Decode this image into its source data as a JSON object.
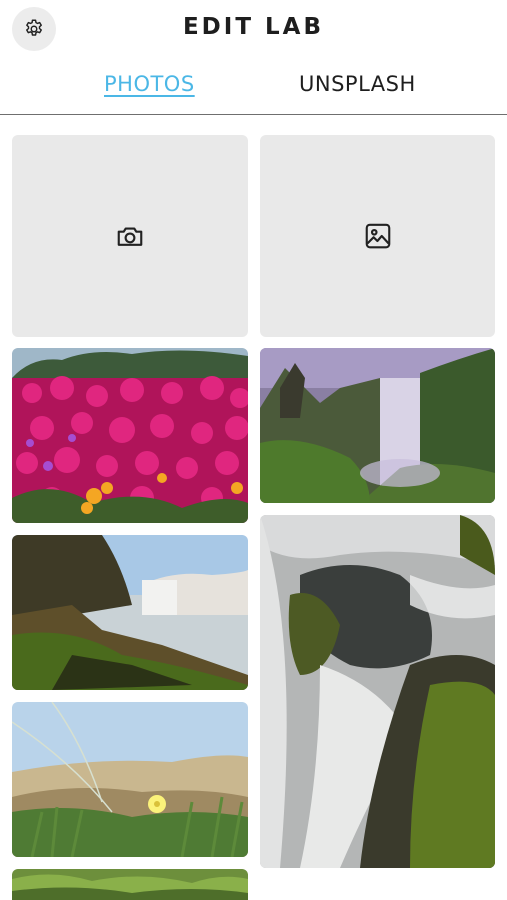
{
  "header": {
    "title": "EDIT LAB",
    "settings_icon": "gear-icon"
  },
  "tabs": [
    {
      "label": "PHOTOS",
      "active": true
    },
    {
      "label": "UNSPLASH",
      "active": false
    }
  ],
  "sources": [
    {
      "icon": "camera-icon"
    },
    {
      "icon": "image-icon"
    }
  ],
  "photos": [
    {
      "subject": "pink flower field"
    },
    {
      "subject": "waterfall in misty gorge"
    },
    {
      "subject": "mossy rocks and waterfall coast"
    },
    {
      "subject": "long exposure waterfall over mossy rocks"
    },
    {
      "subject": "beach dune plants with yellow flower"
    },
    {
      "subject": "green plants"
    }
  ],
  "colors": {
    "accent": "#4bb7e6",
    "text": "#1e1e1e",
    "tile_bg": "#e9e9e9"
  }
}
